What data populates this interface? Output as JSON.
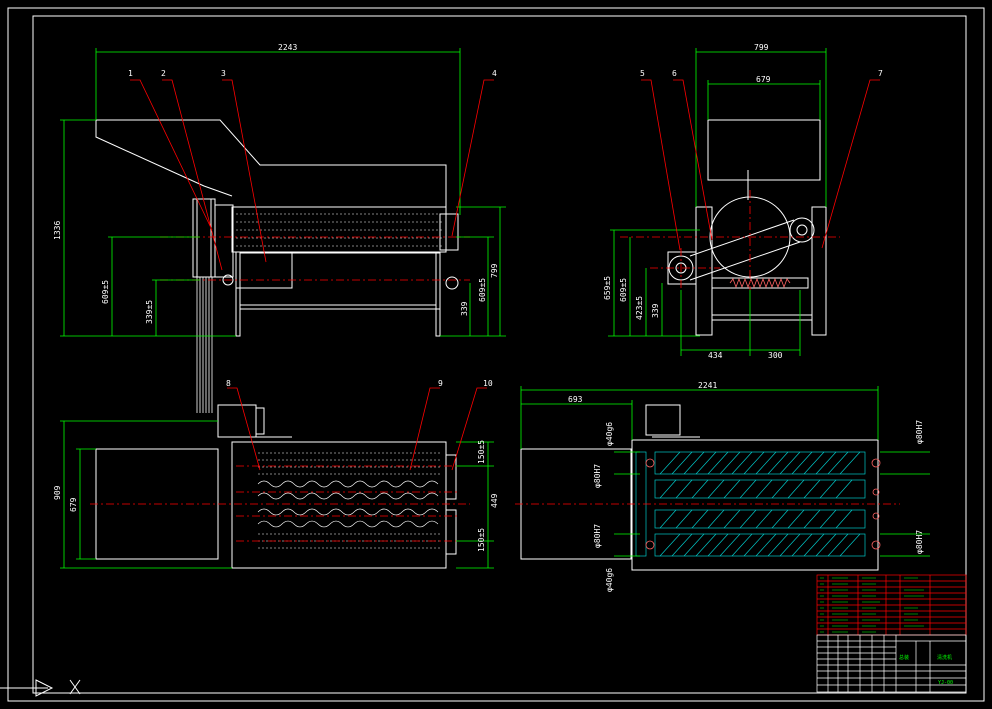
{
  "colors": {
    "background": "#000000",
    "outline": "#ffffff",
    "dimension": "#00ff00",
    "leader": "#ff0000",
    "centerline": "#ff0000",
    "hatch": "#00c8c8",
    "belt": "#ff6464"
  },
  "dimensions": {
    "front_length": "2243",
    "front_height": "1336",
    "front_shaft1": "609±5",
    "front_shaft2": "339±5",
    "front_right1": "339",
    "front_right2": "609±5",
    "front_right3": "799",
    "side_width_outer": "799",
    "side_width_inner": "679",
    "side_h1": "659±5",
    "side_h2": "609±5",
    "side_h3": "423±5",
    "side_h4": "339",
    "side_w1": "434",
    "side_w2": "300",
    "top_width_outer": "909",
    "top_width_inner": "679",
    "top_pitch1": "150±5",
    "top_pitch2": "449",
    "top_pitch3": "150±5",
    "sec_length": "2241",
    "sec_offset": "693",
    "sec_bore1": "φ40g6",
    "sec_bore2": "φ80H7",
    "sec_bore3": "φ80H7",
    "sec_bore4": "φ40g6",
    "sec_bore5": "φ80H7",
    "sec_bore6": "φ80H7"
  },
  "balloons": [
    "1",
    "2",
    "3",
    "4",
    "5",
    "6",
    "7",
    "8",
    "9",
    "10"
  ],
  "title_block": {
    "label1": "总装",
    "label2": "清洗机",
    "drawing_no": "YJ-00"
  }
}
